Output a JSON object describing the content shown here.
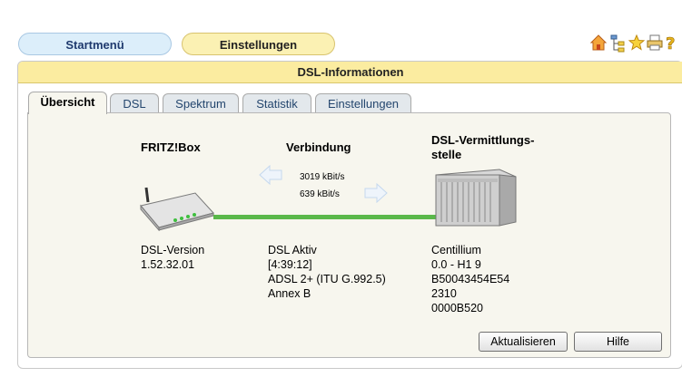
{
  "nav": {
    "start_label": "Startmenü",
    "settings_label": "Einstellungen"
  },
  "toolbar_icons": [
    "home-icon",
    "sitemap-icon",
    "star-icon",
    "print-icon",
    "help-icon"
  ],
  "panel": {
    "title": "DSL-Informationen"
  },
  "tabs": [
    {
      "label": "Übersicht",
      "active": true
    },
    {
      "label": "DSL",
      "active": false
    },
    {
      "label": "Spektrum",
      "active": false
    },
    {
      "label": "Statistik",
      "active": false
    },
    {
      "label": "Einstellungen",
      "active": false
    }
  ],
  "overview": {
    "fritzbox": {
      "title": "FRITZ!Box",
      "version_label": "DSL-Version",
      "version": "1.52.32.01"
    },
    "connection": {
      "title": "Verbindung",
      "downstream": "3019 kBit/s",
      "upstream": "639 kBit/s",
      "status": "DSL Aktiv",
      "duration": "[4:39:12]",
      "mode": "ADSL 2+ (ITU G.992.5)",
      "annex": "Annex B"
    },
    "exchange": {
      "title_line1": "DSL-Vermittlungs-",
      "title_line2": "stelle",
      "vendor": "Centillium",
      "version": "0.0 - H1 9",
      "id": "B50043454E54",
      "code1": "2310",
      "code2": "0000B520"
    }
  },
  "buttons": {
    "refresh": "Aktualisieren",
    "help": "Hilfe"
  },
  "colors": {
    "nav_blue": "#dceefa",
    "nav_yellow": "#fbf1b3",
    "title_bar": "#fbeca0",
    "line": "#5ab84a"
  }
}
